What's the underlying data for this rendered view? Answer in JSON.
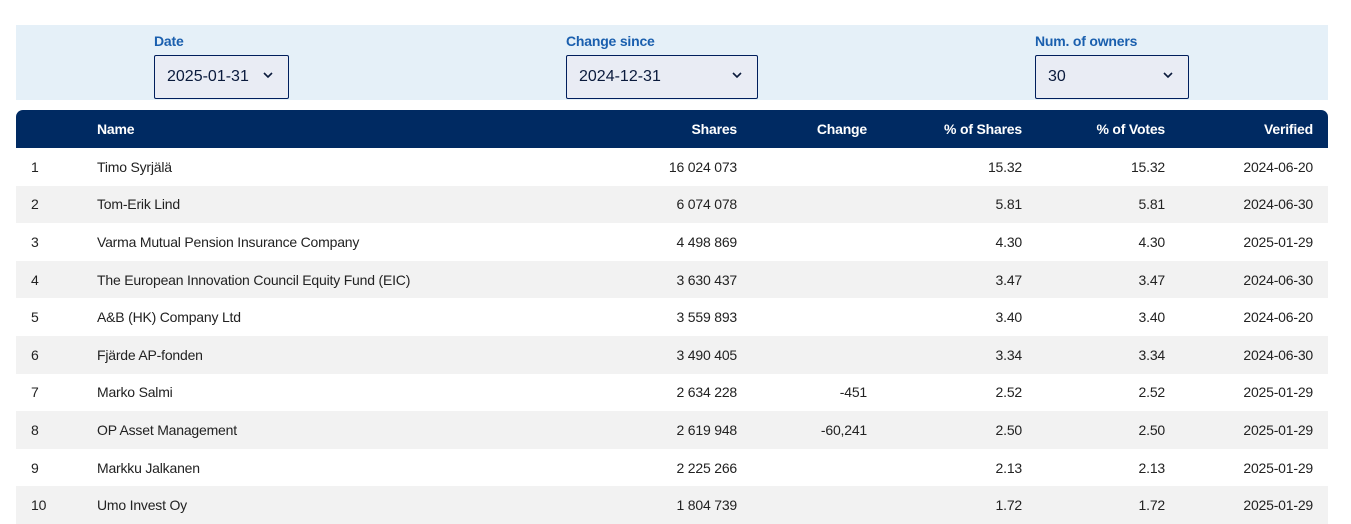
{
  "filters": {
    "date": {
      "label": "Date",
      "value": "2025-01-31"
    },
    "change_since": {
      "label": "Change since",
      "value": "2024-12-31"
    },
    "num_owners": {
      "label": "Num. of owners",
      "value": "30"
    },
    "dropdown_icon": "chevron-down-icon"
  },
  "table": {
    "columns": {
      "rank": "",
      "name": "Name",
      "shares": "Shares",
      "change": "Change",
      "pct_shares": "% of Shares",
      "pct_votes": "% of Votes",
      "verified": "Verified"
    },
    "rows": [
      {
        "rank": "1",
        "name": "Timo Syrjälä",
        "shares": "16 024 073",
        "change": "",
        "pct_shares": "15.32",
        "pct_votes": "15.32",
        "verified": "2024-06-20"
      },
      {
        "rank": "2",
        "name": "Tom-Erik Lind",
        "shares": "6 074 078",
        "change": "",
        "pct_shares": "5.81",
        "pct_votes": "5.81",
        "verified": "2024-06-30"
      },
      {
        "rank": "3",
        "name": "Varma Mutual Pension Insurance Company",
        "shares": "4 498 869",
        "change": "",
        "pct_shares": "4.30",
        "pct_votes": "4.30",
        "verified": "2025-01-29"
      },
      {
        "rank": "4",
        "name": "The European Innovation Council Equity Fund (EIC)",
        "shares": "3 630 437",
        "change": "",
        "pct_shares": "3.47",
        "pct_votes": "3.47",
        "verified": "2024-06-30"
      },
      {
        "rank": "5",
        "name": "A&B (HK) Company Ltd",
        "shares": "3 559 893",
        "change": "",
        "pct_shares": "3.40",
        "pct_votes": "3.40",
        "verified": "2024-06-20"
      },
      {
        "rank": "6",
        "name": "Fjärde AP-fonden",
        "shares": "3 490 405",
        "change": "",
        "pct_shares": "3.34",
        "pct_votes": "3.34",
        "verified": "2024-06-30"
      },
      {
        "rank": "7",
        "name": "Marko Salmi",
        "shares": "2 634 228",
        "change": "-451",
        "pct_shares": "2.52",
        "pct_votes": "2.52",
        "verified": "2025-01-29"
      },
      {
        "rank": "8",
        "name": "OP Asset Management",
        "shares": "2 619 948",
        "change": "-60,241",
        "pct_shares": "2.50",
        "pct_votes": "2.50",
        "verified": "2025-01-29"
      },
      {
        "rank": "9",
        "name": "Markku Jalkanen",
        "shares": "2 225 266",
        "change": "",
        "pct_shares": "2.13",
        "pct_votes": "2.13",
        "verified": "2025-01-29"
      },
      {
        "rank": "10",
        "name": "Umo Invest Oy",
        "shares": "1 804 739",
        "change": "",
        "pct_shares": "1.72",
        "pct_votes": "1.72",
        "verified": "2025-01-29"
      }
    ]
  },
  "colors": {
    "header_bg": "#002a62",
    "filter_bar_bg": "#e5f0f8",
    "label_blue": "#1a5fae",
    "row_alt": "#f2f2f2"
  }
}
